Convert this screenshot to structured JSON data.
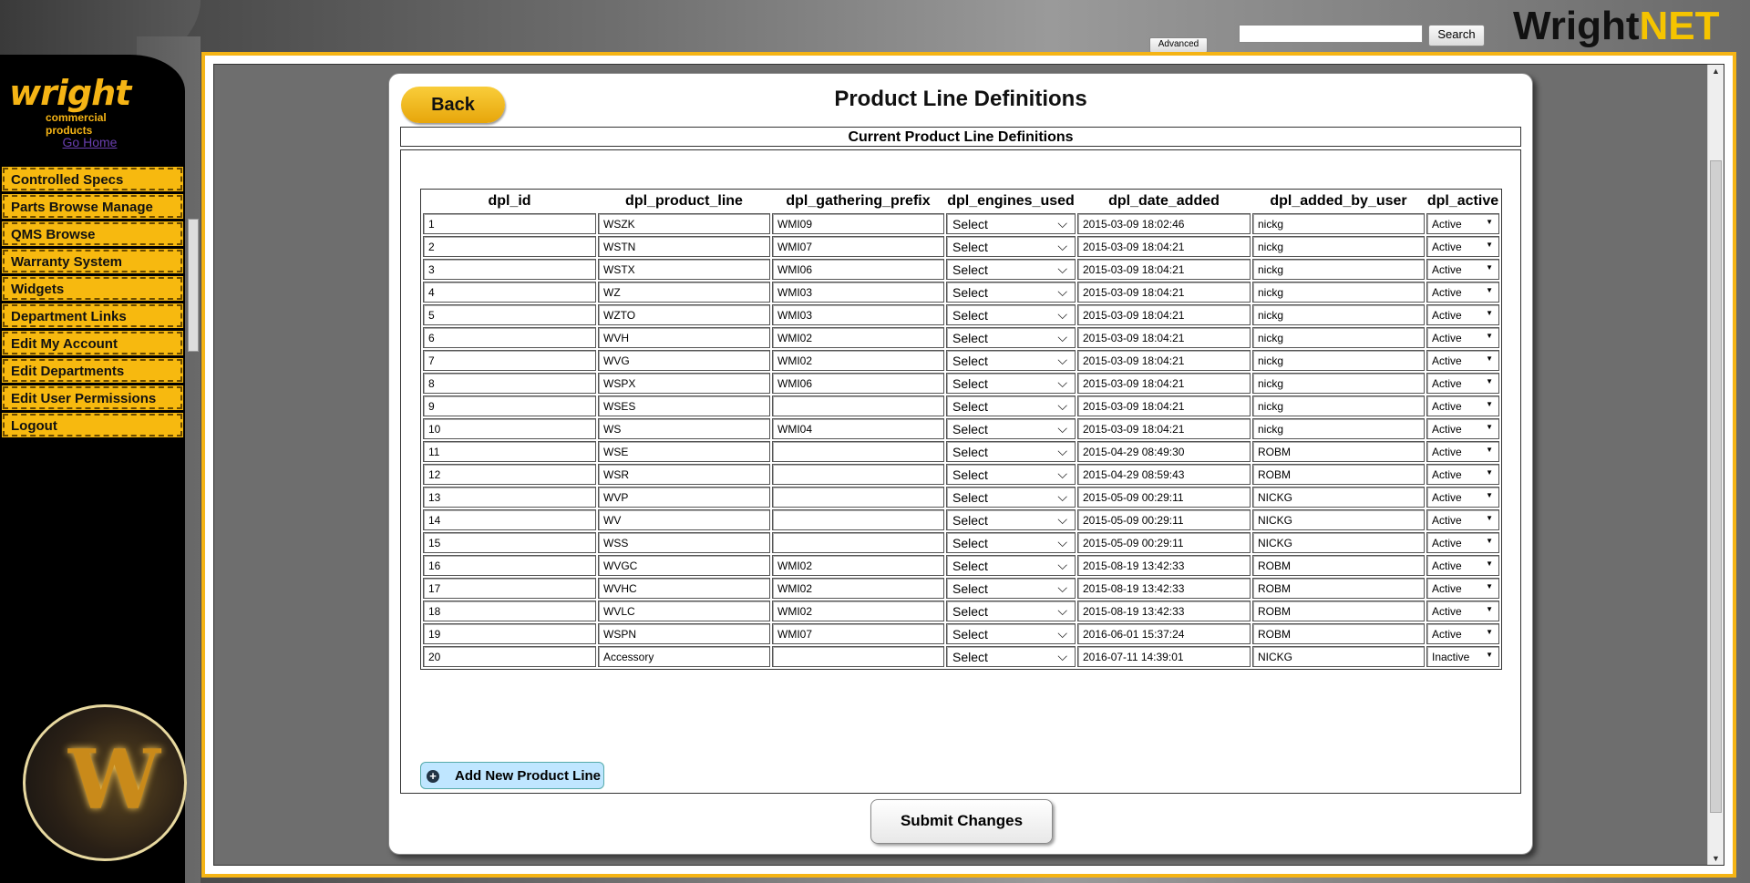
{
  "sidebar": {
    "logo_text": "wright",
    "logo_sub": "commercial products",
    "go_home": "Go Home",
    "items": [
      {
        "label": "Controlled Specs"
      },
      {
        "label": "Parts Browse Manage"
      },
      {
        "label": "QMS Browse"
      },
      {
        "label": "Warranty System"
      },
      {
        "label": "Widgets"
      },
      {
        "label": "Department Links"
      },
      {
        "label": "Edit My Account"
      },
      {
        "label": "Edit Departments"
      },
      {
        "label": "Edit User Permissions"
      },
      {
        "label": "Logout"
      }
    ],
    "badge_letter": "W"
  },
  "header": {
    "brand_a": "Wright",
    "brand_b": "NET",
    "search_value": "",
    "search_label": "Search",
    "advanced_label": "Advanced"
  },
  "page": {
    "back_label": "Back",
    "title": "Product Line Definitions",
    "section_title": "Current Product Line Definitions",
    "add_label": "Add New Product Line",
    "submit_label": "Submit Changes"
  },
  "table": {
    "columns": [
      "dpl_id",
      "dpl_product_line",
      "dpl_gathering_prefix",
      "dpl_engines_used",
      "dpl_date_added",
      "dpl_added_by_user",
      "dpl_active"
    ],
    "rows": [
      [
        "1",
        "WSZK",
        "WMI09",
        "Select",
        "2015-03-09 18:02:46",
        "nickg",
        "Active"
      ],
      [
        "2",
        "WSTN",
        "WMI07",
        "Select",
        "2015-03-09 18:04:21",
        "nickg",
        "Active"
      ],
      [
        "3",
        "WSTX",
        "WMI06",
        "Select",
        "2015-03-09 18:04:21",
        "nickg",
        "Active"
      ],
      [
        "4",
        "WZ",
        "WMI03",
        "Select",
        "2015-03-09 18:04:21",
        "nickg",
        "Active"
      ],
      [
        "5",
        "WZTO",
        "WMI03",
        "Select",
        "2015-03-09 18:04:21",
        "nickg",
        "Active"
      ],
      [
        "6",
        "WVH",
        "WMI02",
        "Select",
        "2015-03-09 18:04:21",
        "nickg",
        "Active"
      ],
      [
        "7",
        "WVG",
        "WMI02",
        "Select",
        "2015-03-09 18:04:21",
        "nickg",
        "Active"
      ],
      [
        "8",
        "WSPX",
        "WMI06",
        "Select",
        "2015-03-09 18:04:21",
        "nickg",
        "Active"
      ],
      [
        "9",
        "WSES",
        "",
        "Select",
        "2015-03-09 18:04:21",
        "nickg",
        "Active"
      ],
      [
        "10",
        "WS",
        "WMI04",
        "Select",
        "2015-03-09 18:04:21",
        "nickg",
        "Active"
      ],
      [
        "11",
        "WSE",
        "",
        "Select",
        "2015-04-29 08:49:30",
        "ROBM",
        "Active"
      ],
      [
        "12",
        "WSR",
        "",
        "Select",
        "2015-04-29 08:59:43",
        "ROBM",
        "Active"
      ],
      [
        "13",
        "WVP",
        "",
        "Select",
        "2015-05-09 00:29:11",
        "NICKG",
        "Active"
      ],
      [
        "14",
        "WV",
        "",
        "Select",
        "2015-05-09 00:29:11",
        "NICKG",
        "Active"
      ],
      [
        "15",
        "WSS",
        "",
        "Select",
        "2015-05-09 00:29:11",
        "NICKG",
        "Active"
      ],
      [
        "16",
        "WVGC",
        "WMI02",
        "Select",
        "2015-08-19 13:42:33",
        "ROBM",
        "Active"
      ],
      [
        "17",
        "WVHC",
        "WMI02",
        "Select",
        "2015-08-19 13:42:33",
        "ROBM",
        "Active"
      ],
      [
        "18",
        "WVLC",
        "WMI02",
        "Select",
        "2015-08-19 13:42:33",
        "ROBM",
        "Active"
      ],
      [
        "19",
        "WSPN",
        "WMI07",
        "Select",
        "2016-06-01 15:37:24",
        "ROBM",
        "Active"
      ],
      [
        "20",
        "Accessory",
        "",
        "Select",
        "2016-07-11 14:39:01",
        "NICKG",
        "Inactive"
      ]
    ]
  },
  "colors": {
    "accent": "#f5b415",
    "add_button": "#bfe6ff",
    "sidebar_bg": "#000000"
  }
}
